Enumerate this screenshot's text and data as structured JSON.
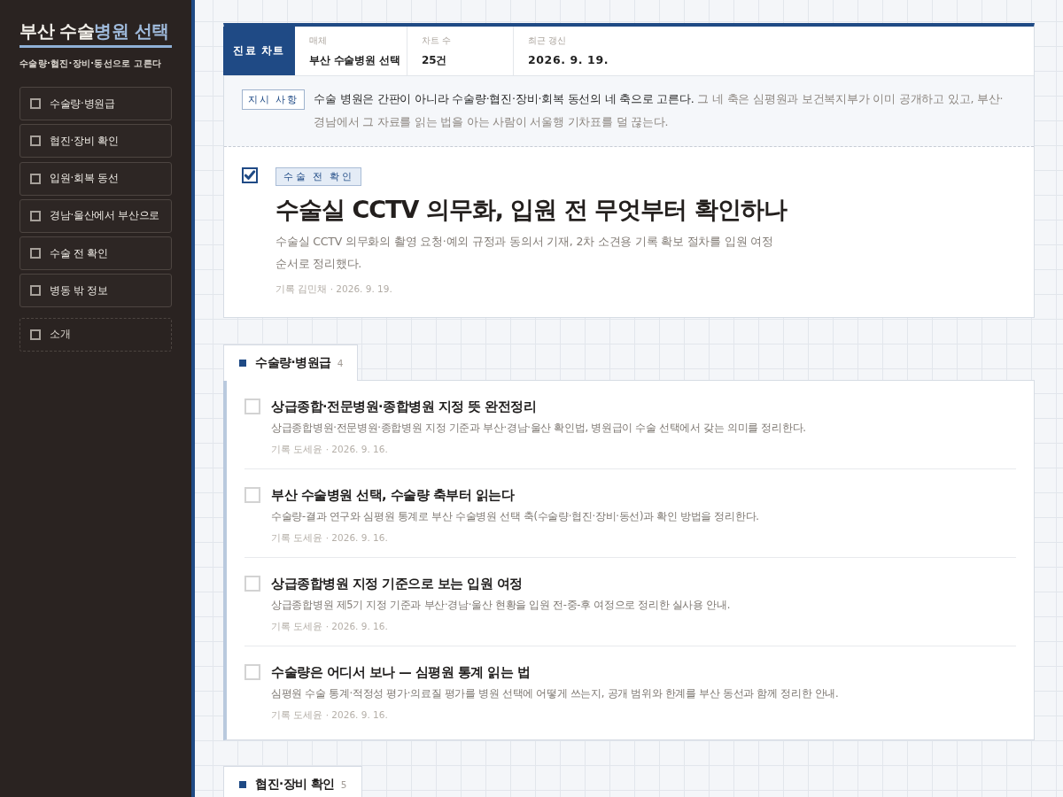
{
  "sidebar": {
    "title": {
      "main": "부산 수술",
      "accent": "병원 선택"
    },
    "subtitle": "수술량·협진·장비·동선으로 고른다",
    "items": [
      {
        "label": "수술량·병원급",
        "kind": "section"
      },
      {
        "label": "협진·장비 확인",
        "kind": "section"
      },
      {
        "label": "입원·회복 동선",
        "kind": "section"
      },
      {
        "label": "경남·울산에서 부산으로",
        "kind": "section"
      },
      {
        "label": "수술 전 확인",
        "kind": "section"
      },
      {
        "label": "병동 밖 정보",
        "kind": "section"
      },
      {
        "label": "소개",
        "kind": "extra"
      }
    ]
  },
  "chart": {
    "badge": "진료 차트",
    "fields": [
      {
        "label": "매체",
        "value": "부산 수술병원 선택"
      },
      {
        "label": "차트 수",
        "value": "25건"
      },
      {
        "label": "최근 갱신",
        "value": "2026. 9. 19."
      }
    ]
  },
  "notice": {
    "tag": "지시 사항",
    "lead": "수술 병원은 간판이 아니라 수술량·협진·장비·회복 동선의 네 축으로 고른다.",
    "text": "그 네 축은 심평원과 보건복지부가 이미 공개하고 있고, 부산·경남에서 그 자료를 읽는 법을 아는 사람이 서울행 기차표를 덜 끊는다."
  },
  "featured": {
    "checked": true,
    "tag": "수술 전 확인",
    "title": "수술실 CCTV 의무화, 입원 전 무엇부터 확인하나",
    "summary": "수술실 CCTV 의무화의 촬영 요청·예외 규정과 동의서 기재, 2차 소견용 기록 확보 절차를 입원 여정 순서로 정리했다.",
    "byline": "기록 김민채 · 2026. 9. 19."
  },
  "sections": [
    {
      "title": "수술량·병원급",
      "count": "4",
      "articles": [
        {
          "checked": false,
          "title": "상급종합·전문병원·종합병원 지정 뜻 완전정리",
          "summary": "상급종합병원·전문병원·종합병원 지정 기준과 부산·경남·울산 확인법, 병원급이 수술 선택에서 갖는 의미를 정리한다.",
          "byline": "기록 도세윤 · 2026. 9. 16."
        },
        {
          "checked": false,
          "title": "부산 수술병원 선택, 수술량 축부터 읽는다",
          "summary": "수술량-결과 연구와 심평원 통계로 부산 수술병원 선택 축(수술량·협진·장비·동선)과 확인 방법을 정리한다.",
          "byline": "기록 도세윤 · 2026. 9. 16."
        },
        {
          "checked": false,
          "title": "상급종합병원 지정 기준으로 보는 입원 여정",
          "summary": "상급종합병원 제5기 지정 기준과 부산·경남·울산 현황을 입원 전-중-후 여정으로 정리한 실사용 안내.",
          "byline": "기록 도세윤 · 2026. 9. 16."
        },
        {
          "checked": false,
          "title": "수술량은 어디서 보나 — 심평원 통계 읽는 법",
          "summary": "심평원 수술 통계·적정성 평가·의료질 평가를 병원 선택에 어떻게 쓰는지, 공개 범위와 한계를 부산 동선과 함께 정리한 안내.",
          "byline": "기록 도세윤 · 2026. 9. 16."
        }
      ]
    },
    {
      "title": "협진·장비 확인",
      "count": "5"
    }
  ]
}
